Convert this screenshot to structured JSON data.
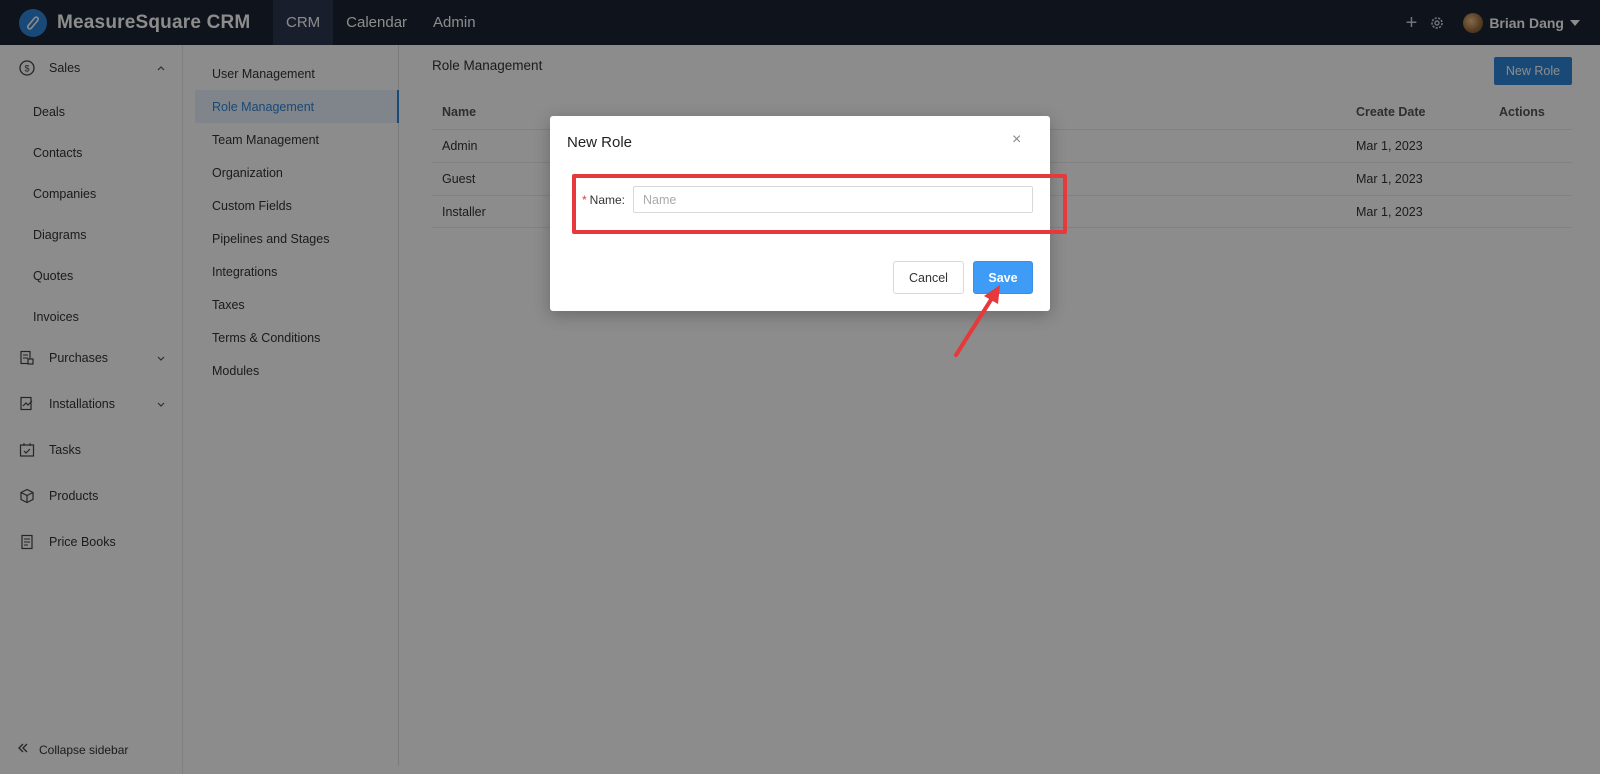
{
  "app": {
    "title": "MeasureSquare CRM"
  },
  "topnav": {
    "items": [
      {
        "label": "CRM"
      },
      {
        "label": "Calendar"
      },
      {
        "label": "Admin"
      }
    ]
  },
  "user": {
    "name": "Brian Dang"
  },
  "sidebar": {
    "sales": "Sales",
    "sales_items": [
      "Deals",
      "Contacts",
      "Companies",
      "Diagrams",
      "Quotes",
      "Invoices"
    ],
    "purchases": "Purchases",
    "installations": "Installations",
    "tasks": "Tasks",
    "products": "Products",
    "price_books": "Price Books",
    "collapse": "Collapse sidebar"
  },
  "admin_menu": {
    "items": [
      "User Management",
      "Role Management",
      "Team Management",
      "Organization",
      "Custom Fields",
      "Pipelines and Stages",
      "Integrations",
      "Taxes",
      "Terms & Conditions",
      "Modules"
    ],
    "active": "Role Management"
  },
  "main": {
    "title": "Role Management",
    "new_role_button": "New Role",
    "columns": {
      "name": "Name",
      "create_date": "Create Date",
      "actions": "Actions"
    },
    "rows": [
      {
        "name": "Admin",
        "create_date": "Mar 1, 2023"
      },
      {
        "name": "Guest",
        "create_date": "Mar 1, 2023"
      },
      {
        "name": "Installer",
        "create_date": "Mar 1, 2023"
      }
    ]
  },
  "modal": {
    "title": "New Role",
    "close": "×",
    "required_mark": "*",
    "name_label": "Name:",
    "name_value": "",
    "name_placeholder": "Name",
    "cancel": "Cancel",
    "save": "Save"
  },
  "colors": {
    "accent": "#2f86d8",
    "save": "#3e9bf6",
    "annotation": "#e5393b",
    "topbar": "#1b2333"
  }
}
